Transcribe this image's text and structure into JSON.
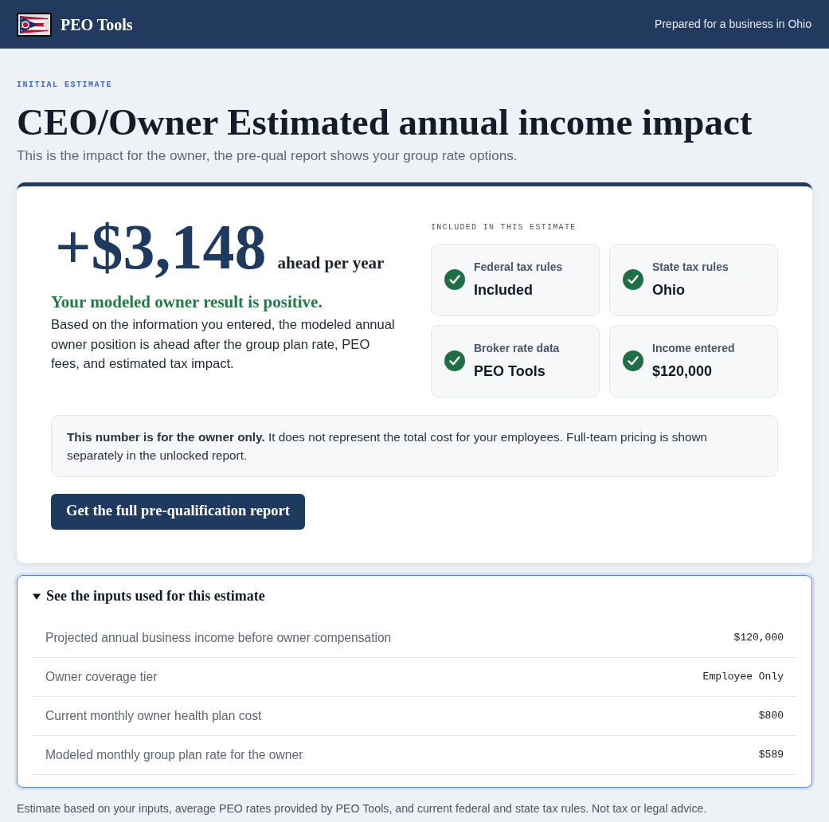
{
  "header": {
    "brand": "PEO Tools",
    "context": "Prepared for a business in Ohio"
  },
  "page": {
    "eyebrow": "INITIAL ESTIMATE",
    "title": "CEO/Owner Estimated annual income impact",
    "subtitle": "This is the impact for the owner, the pre-qual report shows your group rate options."
  },
  "result": {
    "amount": "+$3,148",
    "amount_suffix": "ahead per year",
    "status": "Your modeled owner result is positive.",
    "explanation": "Based on the information you entered, the modeled annual owner position is ahead after the group plan rate, PEO fees, and estimated tax impact.",
    "included_label": "INCLUDED IN THIS ESTIMATE",
    "included": [
      {
        "label": "Federal tax rules",
        "value": "Included"
      },
      {
        "label": "State tax rules",
        "value": "Ohio"
      },
      {
        "label": "Broker rate data",
        "value": "PEO Tools"
      },
      {
        "label": "Income entered",
        "value": "$120,000"
      }
    ],
    "note": "**This number is for the owner only.** It does not represent the total cost for your employees. Full-team pricing is shown separately in the unlocked report.",
    "button": "Get the full pre-qualification report"
  },
  "inputs": {
    "summary": "See the inputs used for this estimate",
    "expanded": true,
    "rows": [
      {
        "label": "Projected annual business income before owner compensation",
        "value": "$120,000"
      },
      {
        "label": "Owner coverage tier",
        "value": "Employee Only"
      },
      {
        "label": "Current monthly owner health plan cost",
        "value": "$800"
      },
      {
        "label": "Modeled monthly group plan rate for the owner",
        "value": "$589"
      }
    ]
  },
  "footer": "Estimate based on your inputs, average PEO rates provided by PEO Tools, and current federal and state tax rules. Not tax or legal advice."
}
